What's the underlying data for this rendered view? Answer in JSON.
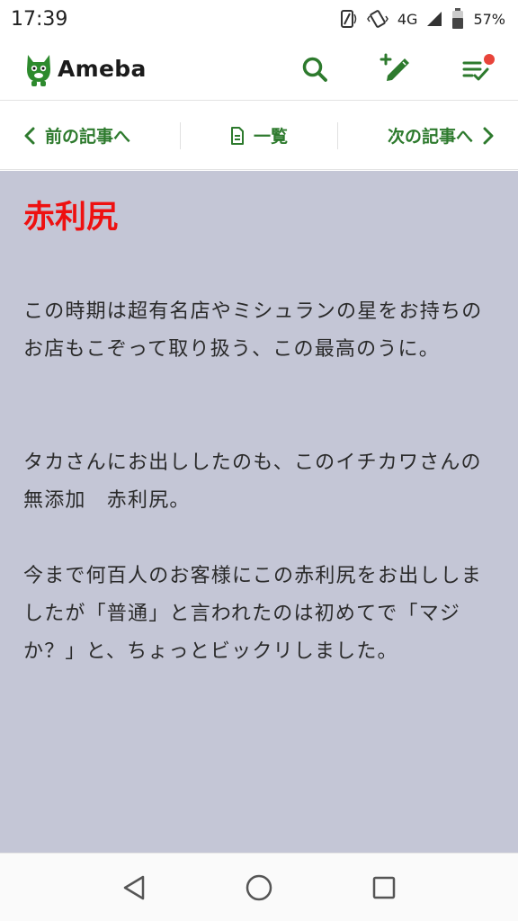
{
  "status_bar": {
    "time": "17:39",
    "network": "4G",
    "battery": "57%"
  },
  "header": {
    "logo_text": "Ameba"
  },
  "article_nav": {
    "prev_label": "前の記事へ",
    "list_label": "一覧",
    "next_label": "次の記事へ"
  },
  "article": {
    "title": "赤利尻",
    "paragraphs": [
      "この時期は超有名店やミシュランの星をお持ちのお店もこぞって取り扱う、この最高のうに。",
      "タカさんにお出ししたのも、このイチカワさんの無添加　赤利尻。",
      "今まで何百人のお客様にこの赤利尻をお出ししましたが「普通」と言われたのは初めてで「マジか？」と、ちょっとビックリしました。"
    ]
  },
  "colors": {
    "brand_green": "#2d7a2d",
    "title_red": "#ee1111",
    "content_bg": "#c4c6d6",
    "notification": "#e8443a"
  }
}
